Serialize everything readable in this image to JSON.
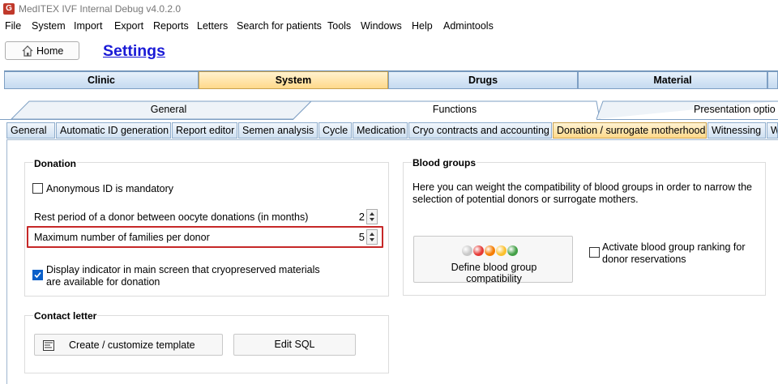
{
  "app": {
    "title": "MedITEX IVF Internal Debug v4.0.2.0",
    "icon": "app-logo-icon"
  },
  "menu": [
    "File",
    "System",
    "Import",
    "Export",
    "Reports",
    "Letters",
    "Search for patients",
    "Tools",
    "Windows",
    "Help",
    "Admintools"
  ],
  "header": {
    "home_label": "Home",
    "page_title": "Settings"
  },
  "main_tabs": [
    {
      "label": "Clinic",
      "active": false
    },
    {
      "label": "System",
      "active": true
    },
    {
      "label": "Drugs",
      "active": false
    },
    {
      "label": "Material",
      "active": false
    }
  ],
  "secondary_tabs": [
    {
      "label": "General",
      "active": false
    },
    {
      "label": "Functions",
      "active": true
    },
    {
      "label": "Presentation optio",
      "active": false
    }
  ],
  "sub_tabs": [
    {
      "label": "General",
      "active": false
    },
    {
      "label": "Automatic ID generation",
      "active": false
    },
    {
      "label": "Report editor",
      "active": false
    },
    {
      "label": "Semen analysis",
      "active": false
    },
    {
      "label": "Cycle",
      "active": false
    },
    {
      "label": "Medication",
      "active": false
    },
    {
      "label": "Cryo contracts and accounting",
      "active": false
    },
    {
      "label": "Donation / surrogate motherhood",
      "active": true
    },
    {
      "label": "Witnessing",
      "active": false
    },
    {
      "label": "W",
      "active": false
    }
  ],
  "donation": {
    "title": "Donation",
    "anonymous_id_label": "Anonymous ID is mandatory",
    "anonymous_id_checked": false,
    "rest_period_label": "Rest period of a donor between oocyte donations (in months)",
    "rest_period_value": "2",
    "max_families_label": "Maximum number of families per donor",
    "max_families_value": "5",
    "display_indicator_label_1": "Display indicator in main screen that cryopreserved materials",
    "display_indicator_label_2": "are available for donation",
    "display_indicator_checked": true
  },
  "contact_letter": {
    "title": "Contact letter",
    "create_template_label": "Create / customize template",
    "edit_sql_label": "Edit SQL"
  },
  "blood_groups": {
    "title": "Blood groups",
    "description_1": "Here you can weight the compatibility of blood groups in order to narrow the",
    "description_2": "selection of potential donors or surrogate mothers.",
    "define_button_label": "Define blood group compatibility",
    "ranking_label_1": "Activate blood group ranking for",
    "ranking_label_2": "donor reservations",
    "ranking_checked": false,
    "dot_colors": [
      "#c8c8c8",
      "#e53935",
      "#f57c00",
      "#fbc02d",
      "#43a047"
    ]
  },
  "colors": {
    "highlight_border": "#c62828",
    "link": "#1a1ad6",
    "active_tab": "#ffd98a"
  }
}
